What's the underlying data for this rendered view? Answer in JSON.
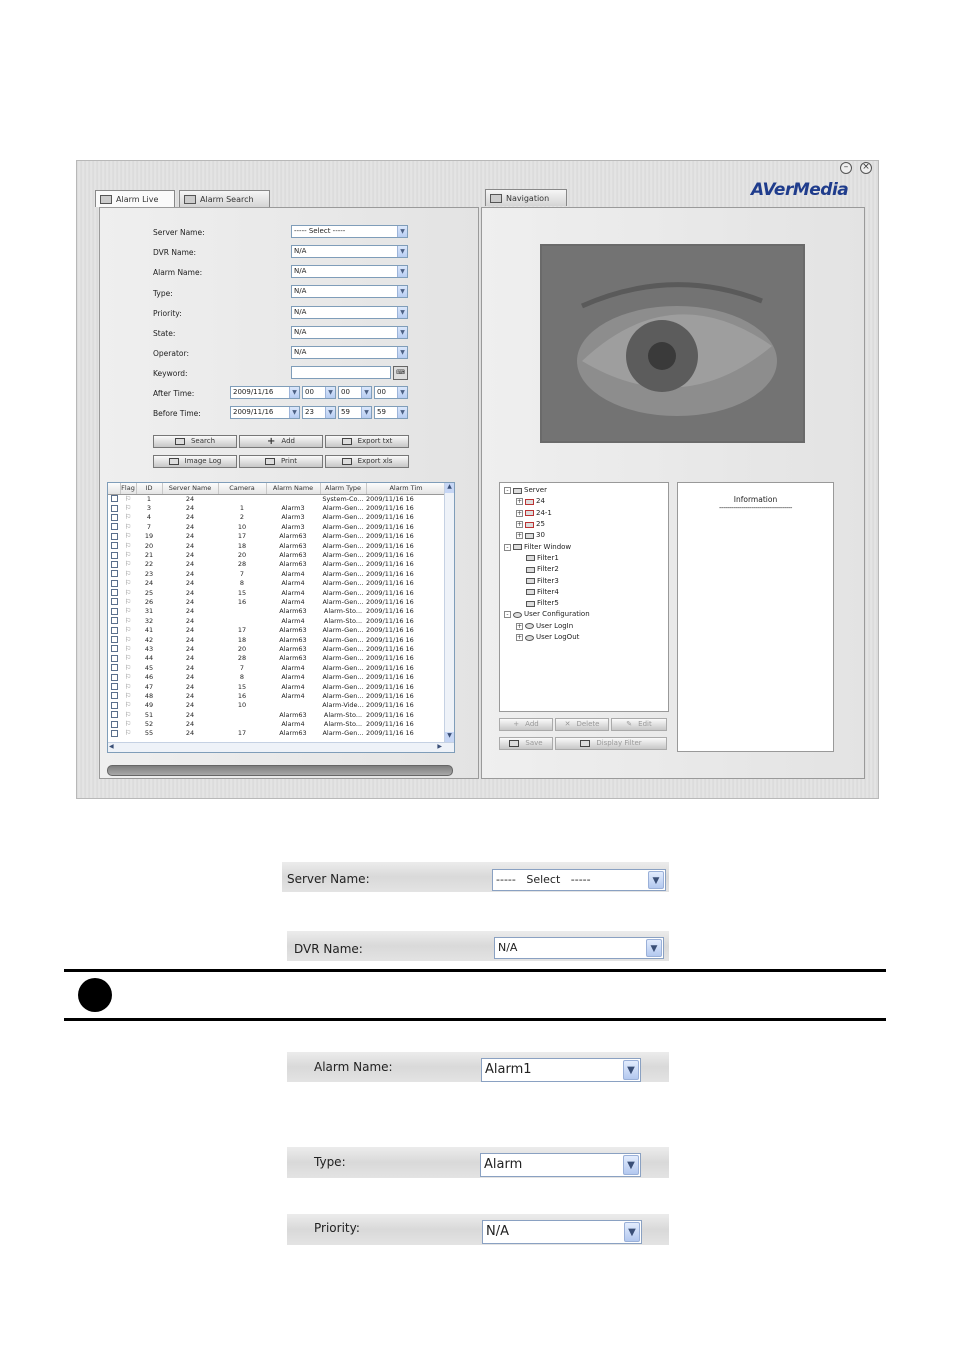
{
  "window": {
    "minimize_icon": "minimize-icon",
    "close_icon": "close-icon",
    "brand": "AVerMedia"
  },
  "tabs": {
    "alarm_live": "Alarm Live",
    "alarm_search": "Alarm Search",
    "navigation": "Navigation"
  },
  "form": {
    "server_name": {
      "label": "Server Name:",
      "value": "-----   Select   -----"
    },
    "dvr_name": {
      "label": "DVR Name:",
      "value": "N/A"
    },
    "alarm_name": {
      "label": "Alarm Name:",
      "value": "N/A"
    },
    "type": {
      "label": "Type:",
      "value": "N/A"
    },
    "priority": {
      "label": "Priority:",
      "value": "N/A"
    },
    "state": {
      "label": "State:",
      "value": "N/A"
    },
    "operator": {
      "label": "Operator:",
      "value": "N/A"
    },
    "keyword": {
      "label": "Keyword:",
      "value": ""
    },
    "after_time": {
      "label": "After Time:",
      "date": "2009/11/16",
      "h": "00",
      "m": "00",
      "s": "00"
    },
    "before_time": {
      "label": "Before Time:",
      "date": "2009/11/16",
      "h": "23",
      "m": "59",
      "s": "59"
    }
  },
  "buttons": {
    "search": "Search",
    "add": "Add",
    "export_txt": "Export txt",
    "image_log": "Image Log",
    "print": "Print",
    "export_xls": "Export xls"
  },
  "table": {
    "columns": [
      "Flag",
      "ID",
      "Server Name",
      "Camera",
      "Alarm Name",
      "Alarm Type",
      "Alarm Tim"
    ],
    "rows": [
      [
        "1",
        "24",
        "",
        "",
        "System-Co...",
        "2009/11/16 16"
      ],
      [
        "3",
        "24",
        "1",
        "Alarm3",
        "Alarm-Gen...",
        "2009/11/16 16"
      ],
      [
        "4",
        "24",
        "2",
        "Alarm3",
        "Alarm-Gen...",
        "2009/11/16 16"
      ],
      [
        "7",
        "24",
        "10",
        "Alarm3",
        "Alarm-Gen...",
        "2009/11/16 16"
      ],
      [
        "19",
        "24",
        "17",
        "Alarm63",
        "Alarm-Gen...",
        "2009/11/16 16"
      ],
      [
        "20",
        "24",
        "18",
        "Alarm63",
        "Alarm-Gen...",
        "2009/11/16 16"
      ],
      [
        "21",
        "24",
        "20",
        "Alarm63",
        "Alarm-Gen...",
        "2009/11/16 16"
      ],
      [
        "22",
        "24",
        "28",
        "Alarm63",
        "Alarm-Gen...",
        "2009/11/16 16"
      ],
      [
        "23",
        "24",
        "7",
        "Alarm4",
        "Alarm-Gen...",
        "2009/11/16 16"
      ],
      [
        "24",
        "24",
        "8",
        "Alarm4",
        "Alarm-Gen...",
        "2009/11/16 16"
      ],
      [
        "25",
        "24",
        "15",
        "Alarm4",
        "Alarm-Gen...",
        "2009/11/16 16"
      ],
      [
        "26",
        "24",
        "16",
        "Alarm4",
        "Alarm-Gen...",
        "2009/11/16 16"
      ],
      [
        "31",
        "24",
        "",
        "Alarm63",
        "Alarm-Sto...",
        "2009/11/16 16"
      ],
      [
        "32",
        "24",
        "",
        "Alarm4",
        "Alarm-Sto...",
        "2009/11/16 16"
      ],
      [
        "41",
        "24",
        "17",
        "Alarm63",
        "Alarm-Gen...",
        "2009/11/16 16"
      ],
      [
        "42",
        "24",
        "18",
        "Alarm63",
        "Alarm-Gen...",
        "2009/11/16 16"
      ],
      [
        "43",
        "24",
        "20",
        "Alarm63",
        "Alarm-Gen...",
        "2009/11/16 16"
      ],
      [
        "44",
        "24",
        "28",
        "Alarm63",
        "Alarm-Gen...",
        "2009/11/16 16"
      ],
      [
        "45",
        "24",
        "7",
        "Alarm4",
        "Alarm-Gen...",
        "2009/11/16 16"
      ],
      [
        "46",
        "24",
        "8",
        "Alarm4",
        "Alarm-Gen...",
        "2009/11/16 16"
      ],
      [
        "47",
        "24",
        "15",
        "Alarm4",
        "Alarm-Gen...",
        "2009/11/16 16"
      ],
      [
        "48",
        "24",
        "16",
        "Alarm4",
        "Alarm-Gen...",
        "2009/11/16 16"
      ],
      [
        "49",
        "24",
        "10",
        "",
        "Alarm-Vide...",
        "2009/11/16 16"
      ],
      [
        "51",
        "24",
        "",
        "Alarm63",
        "Alarm-Sto...",
        "2009/11/16 16"
      ],
      [
        "52",
        "24",
        "",
        "Alarm4",
        "Alarm-Sto...",
        "2009/11/16 16"
      ],
      [
        "55",
        "24",
        "17",
        "Alarm63",
        "Alarm-Gen...",
        "2009/11/16 16"
      ]
    ]
  },
  "tree": {
    "server": "Server",
    "s1": "24",
    "s2": "24-1",
    "s3": "25",
    "s4": "30",
    "filter_window": "Filter Window",
    "f1": "Filter1",
    "f2": "Filter2",
    "f3": "Filter3",
    "f4": "Filter4",
    "f5": "Filter5",
    "user_config": "User Configuration",
    "u1": "User LogIn",
    "u2": "User LogOut"
  },
  "nav_buttons": {
    "add": "Add",
    "delete": "Delete",
    "edit": "Edit",
    "save": "Save",
    "display_filter": "Display Filter"
  },
  "info": {
    "title": "Information",
    "divider": "------------------------------------"
  },
  "zoom": {
    "server_name": {
      "label": "Server Name:",
      "value": "-----   Select   -----"
    },
    "dvr_name": {
      "label": "DVR Name:",
      "value": "N/A"
    },
    "alarm_name": {
      "label": "Alarm Name:",
      "value": "Alarm1"
    },
    "type": {
      "label": "Type:",
      "value": "Alarm"
    },
    "priority": {
      "label": "Priority:",
      "value": "N/A"
    }
  },
  "colors": {
    "accent_blue": "#7f9db9",
    "brand_blue": "#1f3c8c"
  }
}
